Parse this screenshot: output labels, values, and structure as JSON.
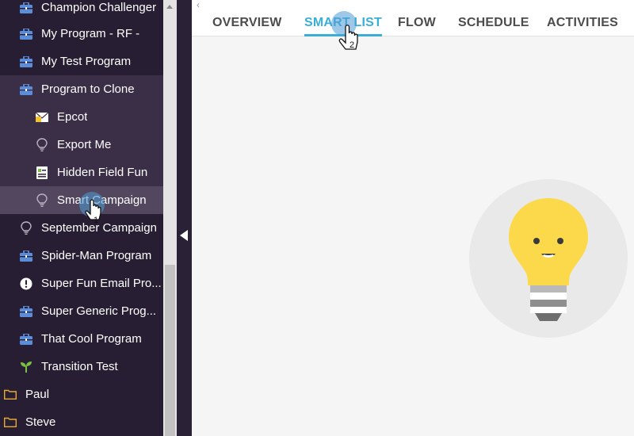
{
  "sidebar": {
    "items": [
      {
        "label": "Champion Challenger",
        "icon": "program-briefcase-icon"
      },
      {
        "label": "My Program - RF -",
        "icon": "program-briefcase-icon"
      },
      {
        "label": "My Test Program",
        "icon": "program-briefcase-icon"
      },
      {
        "label": "Program to Clone",
        "icon": "program-briefcase-icon"
      },
      {
        "label": "Epcot",
        "icon": "email-envelope-icon"
      },
      {
        "label": "Export Me",
        "icon": "smart-campaign-bulb-icon"
      },
      {
        "label": "Hidden Field Fun",
        "icon": "form-icon"
      },
      {
        "label": "Smart Campaign",
        "icon": "smart-campaign-bulb-icon"
      },
      {
        "label": "September Campaign",
        "icon": "smart-campaign-bulb-icon"
      },
      {
        "label": "Spider-Man Program",
        "icon": "program-briefcase-icon"
      },
      {
        "label": "Super Fun Email Pro...",
        "icon": "alert-circle-icon"
      },
      {
        "label": "Super Generic Prog...",
        "icon": "program-briefcase-icon"
      },
      {
        "label": "That Cool Program",
        "icon": "program-briefcase-icon"
      },
      {
        "label": "Transition Test",
        "icon": "nurture-sprout-icon"
      },
      {
        "label": "Paul",
        "icon": "folder-icon"
      },
      {
        "label": "Steve",
        "icon": "folder-icon"
      }
    ]
  },
  "tabs": [
    {
      "label": "OVERVIEW"
    },
    {
      "label": "SMART LIST"
    },
    {
      "label": "FLOW"
    },
    {
      "label": "SCHEDULE"
    },
    {
      "label": "ACTIVITIES"
    }
  ],
  "annotations": {
    "step1": "1",
    "step2": "2"
  },
  "colors": {
    "sidebar_bg": "#281e33",
    "group_bg": "#3b2f48",
    "selected_bg": "#52475e",
    "active_tab": "#3aaed8",
    "briefcase": "#5b8dd9",
    "bulb_yellow": "#fcd94a",
    "folder": "#e8a92e",
    "sprout": "#7bc043"
  }
}
